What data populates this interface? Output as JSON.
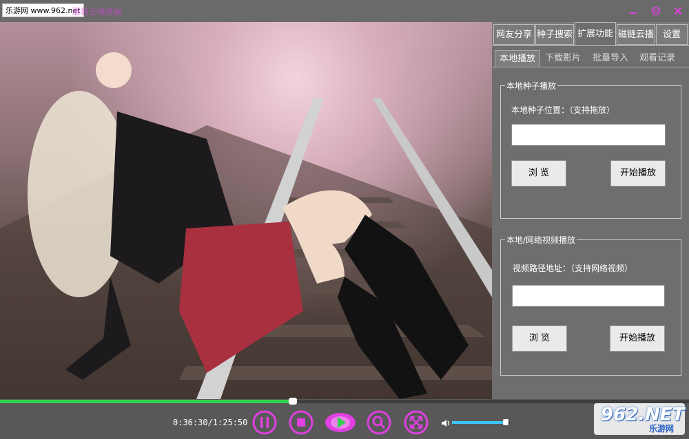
{
  "watermark": "乐游网 www.962.net",
  "app_title": "蘑菇云播放器",
  "window_controls": {
    "minimize_icon": "minimize-icon",
    "settings_icon": "gear-icon",
    "close_icon": "close-icon"
  },
  "tabs": [
    "网友分享",
    "种子搜索",
    "扩展功能",
    "磁链云播",
    "设置"
  ],
  "active_tab": "扩展功能",
  "subtabs": [
    "本地播放",
    "下载影片",
    "批量导入",
    "观看记录"
  ],
  "active_subtab": "本地播放",
  "local_torrent": {
    "title": "本地种子播放",
    "label": "本地种子位置：（支持拖放）",
    "value": "",
    "browse": "浏  览",
    "play": "开始播放"
  },
  "net_video": {
    "title": "本地/网络视频播放",
    "label": "视频路径地址：（支持网络视频）",
    "value": "",
    "browse": "浏 览",
    "play": "开始播放"
  },
  "player": {
    "time": "0:36:30/1:25:50",
    "progress": 0.425,
    "volume": 0.98
  },
  "logo": {
    "main": "962.NET",
    "sub": "乐游网"
  },
  "colors": {
    "accent": "#e040e0",
    "progress": "#2fd24a",
    "volume": "#3ec4ff"
  }
}
